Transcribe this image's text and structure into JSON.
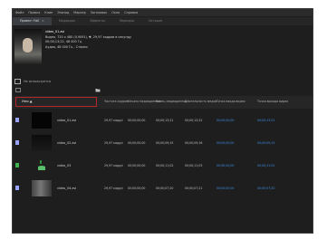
{
  "app": {
    "menu": [
      "Файл",
      "Правка",
      "Клип",
      "Эпизод",
      "Маркер",
      "Заголовок",
      "Окно",
      "Справка"
    ]
  },
  "tabs": [
    {
      "label": "Проект: Fаll",
      "active": true
    },
    {
      "label": "Медиадан",
      "active": false
    },
    {
      "label": "Эффекты",
      "active": false
    },
    {
      "label": "Маркеры",
      "active": false
    },
    {
      "label": "История",
      "active": false
    }
  ],
  "preview": {
    "filename": "video_01.avi",
    "line1": "Видео, 720 x 480 (0,9091), ▼, 29,97 кадров в секунду",
    "line2": "00;00;13;22, 48 000 Гц",
    "line3": "Аудио, 48 000 Гц - Стерео"
  },
  "usage": {
    "label": "Не используется"
  },
  "columns": {
    "name": "Имя",
    "rate": "Частота кадров",
    "media_start": "Начало медиаданных",
    "media_end": "Конец медиаданных",
    "duration": "Длительность медиа",
    "video_in": "Точка входа видео",
    "video_out": "Точка выхода видео"
  },
  "rows": [
    {
      "name": "video_01.avi",
      "swatch": "#9aa4ff",
      "rate": "29,97 кадр/с",
      "start": "00;00;00;00",
      "end": "00;00;13;21",
      "duration": "00;00;13;22",
      "vin": "00;00;00;00",
      "vout": "00;00;13;21",
      "thumb": "black"
    },
    {
      "name": "video_02.avi",
      "swatch": "#9aa4ff",
      "rate": "29,97 кадр/с",
      "start": "00;00;00;00",
      "end": "00;00;09;15",
      "duration": "00;00;09;16",
      "vin": "00;00;00;00",
      "vout": "00;00;09;15",
      "thumb": "one"
    },
    {
      "name": "video_03",
      "swatch": "#3fb24a",
      "rate": "29,97 кадр/с",
      "start": "00;00;00;00",
      "end": "00;00;11;02",
      "duration": "00;00;11;03",
      "vin": "00;00;00;00",
      "vout": "00;00;11;02",
      "thumb": "audio"
    },
    {
      "name": "video_04.avi",
      "swatch": "#9aa4ff",
      "rate": "29,97 кадр/с",
      "start": "00;00;00;00",
      "end": "00;00;07;20",
      "duration": "00;00;07;21",
      "vin": "00;00;00;00",
      "vout": "00;00;07;20",
      "thumb": "two"
    }
  ],
  "colors": {
    "accent": "#3d8ee6",
    "highlight": "#b3262a"
  },
  "icons": [
    "new-bin-icon",
    "folder-icon",
    "file-icon",
    "audio-icon"
  ]
}
